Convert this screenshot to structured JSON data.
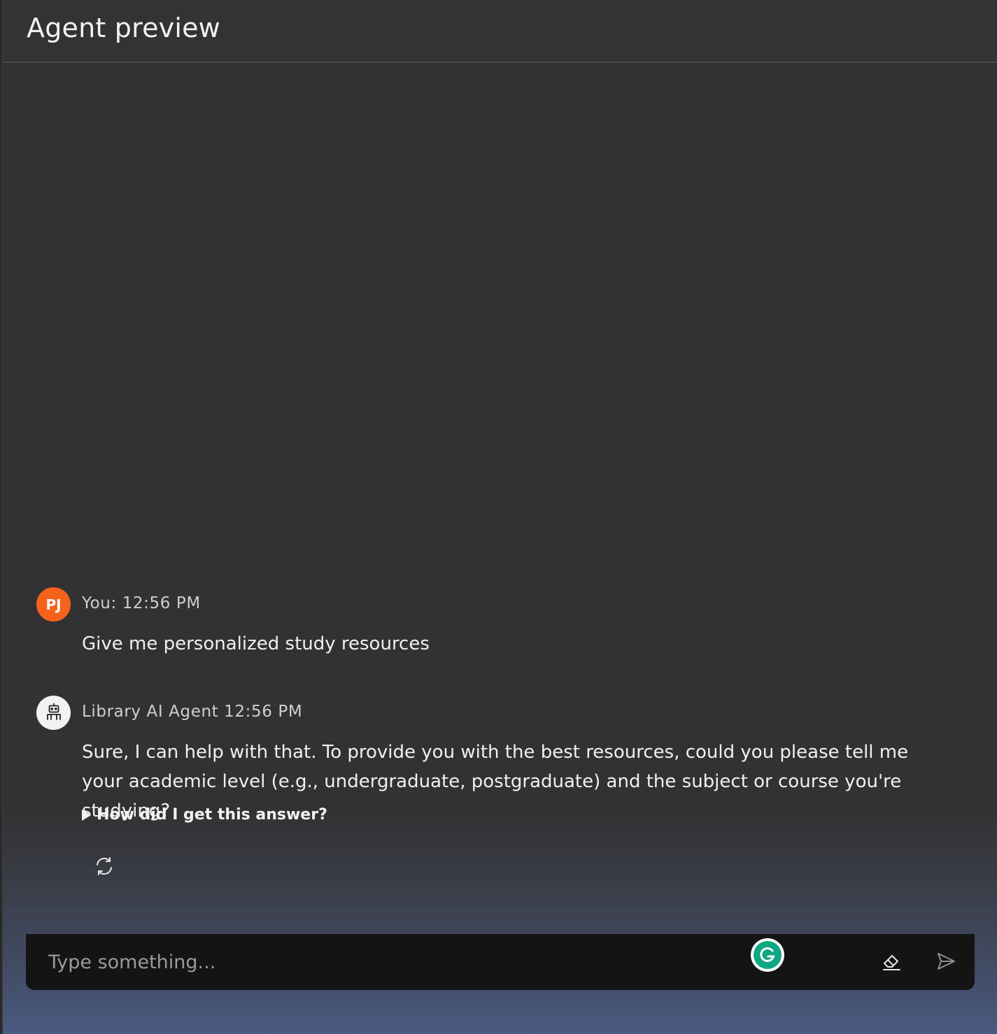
{
  "header": {
    "title": "Agent preview"
  },
  "messages": {
    "user": {
      "avatar_initials": "PJ",
      "meta": "You: 12:56 PM",
      "text": "Give me personalized study resources"
    },
    "agent": {
      "meta": "Library AI Agent 12:56 PM",
      "text": "Sure, I can help with that. To provide you with the best resources, could you please tell me your academic level (e.g., undergraduate, postgraduate) and the subject or course you're studying?",
      "details_label": "How did I get this answer?"
    }
  },
  "composer": {
    "placeholder": "Type something...",
    "value": ""
  },
  "icons": {
    "regenerate": "refresh-icon",
    "agent_avatar": "robot-icon",
    "grammarly": "grammarly-icon",
    "erase": "eraser-icon",
    "send": "send-icon"
  },
  "colors": {
    "user_avatar": "#f5621c",
    "grammarly": "#11a683",
    "background": "#323232",
    "input_bar": "#141414"
  }
}
